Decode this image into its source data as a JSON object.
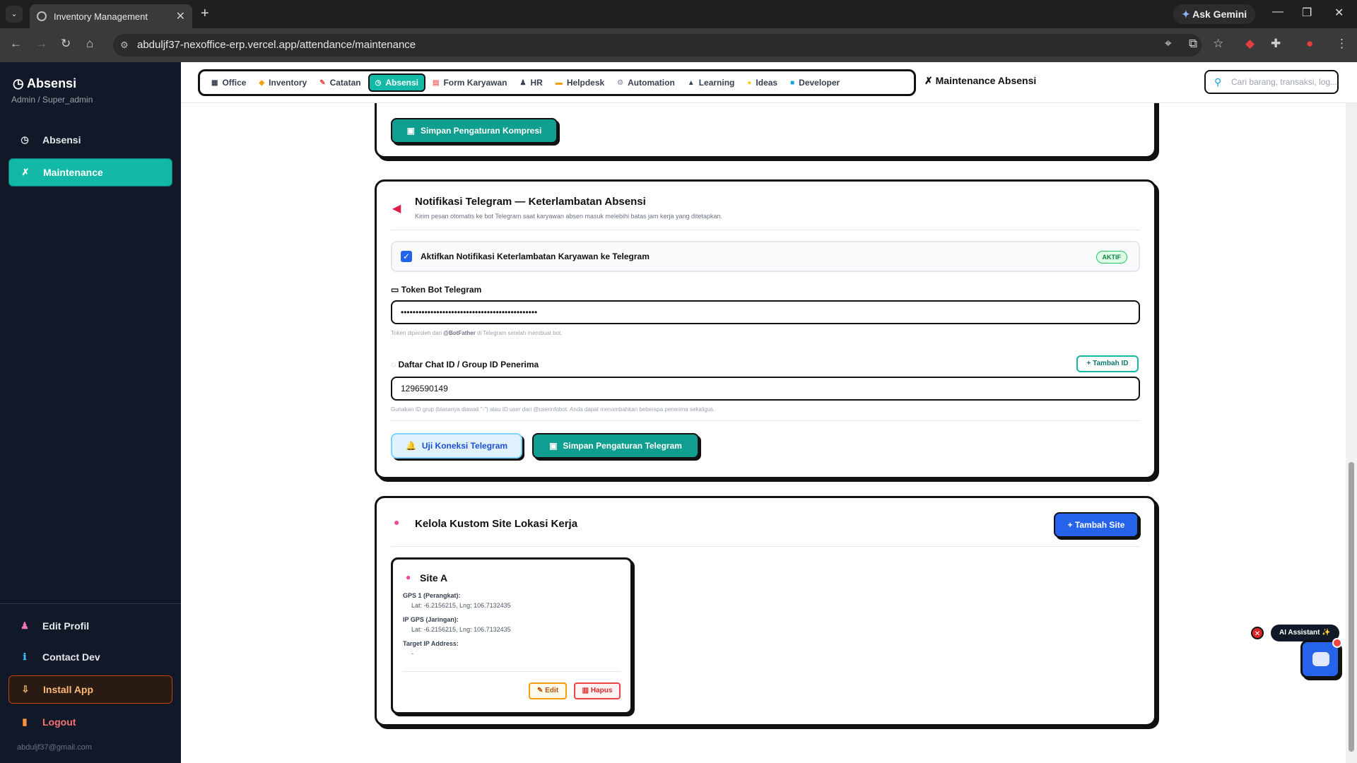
{
  "browser": {
    "tab_title": "Inventory Management",
    "url": "abduljf37-nexoffice-erp.vercel.app/attendance/maintenance",
    "gemini_label": "Ask Gemini"
  },
  "sidebar": {
    "title": "Absensi",
    "subtitle": "Admin / Super_admin",
    "items": [
      {
        "label": "Absensi",
        "icon": "clock-icon"
      },
      {
        "label": "Maintenance",
        "icon": "tools-icon"
      }
    ],
    "bottom": [
      {
        "label": "Edit Profil",
        "icon": "user-icon"
      },
      {
        "label": "Contact Dev",
        "icon": "info-icon"
      },
      {
        "label": "Install App",
        "icon": "install-icon"
      },
      {
        "label": "Logout",
        "icon": "logout-icon"
      }
    ],
    "email": "abduljf37@gmail.com"
  },
  "topnav": {
    "links": [
      "Office",
      "Inventory",
      "Catatan",
      "Absensi",
      "Form Karyawan",
      "HR",
      "Helpdesk",
      "Automation",
      "Learning",
      "Ideas",
      "Developer"
    ],
    "active": "Absensi",
    "page_title": "Maintenance Absensi",
    "search_placeholder": "Cari barang, transaksi, log..."
  },
  "compression": {
    "save_label": "Simpan Pengaturan Kompresi"
  },
  "telegram": {
    "title": "Notifikasi Telegram — Keterlambatan Absensi",
    "desc": "Kirim pesan otomatis ke bot Telegram saat karyawan absen masuk melebihi batas jam kerja yang ditetapkan.",
    "toggle_label": "Aktifkan Notifikasi Keterlambatan Karyawan ke Telegram",
    "toggle_checked": true,
    "status_badge": "AKTIF",
    "token_label": "Token Bot Telegram",
    "token_value": "••••••••••••••••••••••••••••••••••••••••••••••",
    "token_hint_pre": "Token diperoleh dari",
    "token_hint_bold": "@BotFather",
    "token_hint_post": "di Telegram setelah membuat bot.",
    "chat_label": "Daftar Chat ID / Group ID Penerima",
    "add_id_label": "+ Tambah ID",
    "chat_value": "1296590149",
    "chat_hint": "Gunakan ID grup (biasanya diawali \"-\") atau ID user dari @userinfobot. Anda dapat menambahkan beberapa penerima sekaligus.",
    "test_label": "Uji Koneksi Telegram",
    "save_label": "Simpan Pengaturan Telegram"
  },
  "sites": {
    "title": "Kelola Kustom Site Lokasi Kerja",
    "add_label": "+ Tambah Site",
    "cards": [
      {
        "name": "Site A",
        "gps1_label": "GPS 1 (Perangkat):",
        "gps1_value": "Lat: -6.2156215, Lng: 106.7132435",
        "ipgps_label": "IP GPS (Jaringan):",
        "ipgps_value": "Lat: -6.2156215, Lng: 106.7132435",
        "target_label": "Target IP Address:",
        "target_value": "-",
        "edit_label": "Edit",
        "delete_label": "Hapus"
      }
    ]
  },
  "assistant": {
    "label": "AI Assistant ✨"
  }
}
